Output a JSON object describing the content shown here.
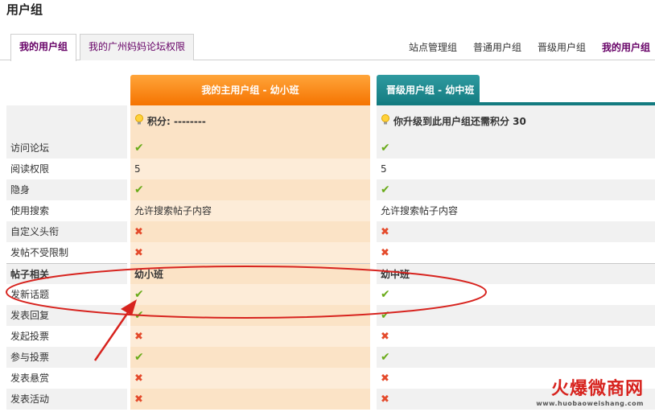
{
  "page": {
    "title": "用户组"
  },
  "tabs": [
    {
      "label": "我的用户组",
      "active": true
    },
    {
      "label": "我的广州妈妈论坛权限",
      "active": false
    }
  ],
  "right_links": [
    "站点管理组",
    "普通用户组",
    "晋级用户组",
    "我的用户组"
  ],
  "columns": {
    "current": {
      "title": "我的主用户组 - 幼小班",
      "color": "#f57300"
    },
    "next": {
      "title": "晋级用户组 - 幼中班",
      "color": "#137b80"
    }
  },
  "points": {
    "current": "积分: --------",
    "next": "你升级到此用户组还需积分 30"
  },
  "rows": [
    {
      "label": "访问论坛",
      "v1": "ok",
      "v2": "ok"
    },
    {
      "label": "阅读权限",
      "v1": "5",
      "v2": "5"
    },
    {
      "label": "隐身",
      "v1": "ok",
      "v2": "ok"
    },
    {
      "label": "使用搜索",
      "v1": "允许搜索帖子内容",
      "v2": "允许搜索帖子内容"
    },
    {
      "label": "自定义头衔",
      "v1": "no",
      "v2": "no"
    },
    {
      "label": "发帖不受限制",
      "v1": "no",
      "v2": "no"
    },
    {
      "label": "帖子相关",
      "v1": "幼小班",
      "v2": "幼中班",
      "section": true
    },
    {
      "label": "发新话题",
      "v1": "ok",
      "v2": "ok"
    },
    {
      "label": "发表回复",
      "v1": "ok",
      "v2": "ok"
    },
    {
      "label": "发起投票",
      "v1": "no",
      "v2": "no"
    },
    {
      "label": "参与投票",
      "v1": "ok",
      "v2": "ok"
    },
    {
      "label": "发表悬赏",
      "v1": "no",
      "v2": "no"
    },
    {
      "label": "发表活动",
      "v1": "no",
      "v2": "no"
    }
  ],
  "watermark": {
    "name": "火爆微商网",
    "url": "www.huobaoweishang.com"
  },
  "colors": {
    "ok": "#6aab1a",
    "no": "#e44a2b",
    "annotation": "#d7231e"
  }
}
